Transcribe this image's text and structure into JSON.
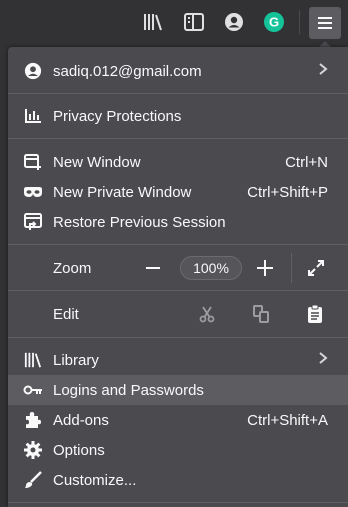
{
  "toolbar": {
    "icons": [
      "library-icon",
      "sidebar-icon",
      "account-icon",
      "grammarly-icon",
      "menu-icon"
    ],
    "grammarly_color": "#15c39a"
  },
  "account": {
    "email": "sadiq.012@gmail.com"
  },
  "menu": {
    "privacy": "Privacy Protections",
    "new_window": {
      "label": "New Window",
      "shortcut": "Ctrl+N"
    },
    "new_private": {
      "label": "New Private Window",
      "shortcut": "Ctrl+Shift+P"
    },
    "restore": "Restore Previous Session",
    "zoom": {
      "label": "Zoom",
      "minus": "−",
      "value": "100%",
      "plus": "+"
    },
    "edit": {
      "label": "Edit"
    },
    "library": "Library",
    "logins": "Logins and Passwords",
    "addons": {
      "label": "Add-ons",
      "shortcut": "Ctrl+Shift+A"
    },
    "options": "Options",
    "customize": "Customize..."
  },
  "colors": {
    "panel": "#4a4a4f",
    "hover": "#5c5c61",
    "toolbar": "#323234"
  }
}
